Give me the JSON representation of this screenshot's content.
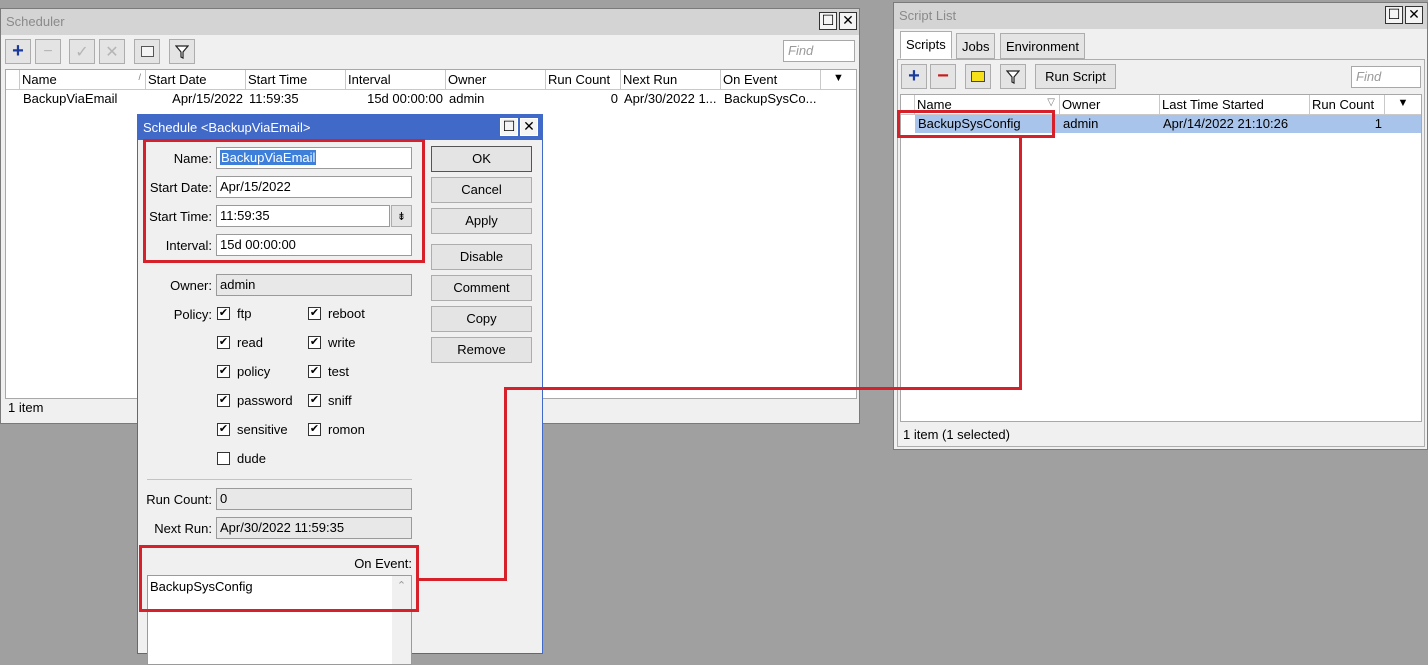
{
  "scheduler": {
    "title": "Scheduler",
    "find_placeholder": "Find",
    "columns": [
      "Name",
      "Start Date",
      "Start Time",
      "Interval",
      "Owner",
      "Run Count",
      "Next Run",
      "On Event"
    ],
    "rows": [
      {
        "name": "BackupViaEmail",
        "start_date": "Apr/15/2022",
        "start_time": "11:59:35",
        "interval": "15d 00:00:00",
        "owner": "admin",
        "run_count": "0",
        "next_run": "Apr/30/2022 1...",
        "on_event": "BackupSysCo..."
      }
    ],
    "status": "1 item"
  },
  "dialog": {
    "title": "Schedule <BackupViaEmail>",
    "name_label": "Name:",
    "name_value": "BackupViaEmail",
    "start_date_label": "Start Date:",
    "start_date_value": "Apr/15/2022",
    "start_time_label": "Start Time:",
    "start_time_value": "11:59:35",
    "interval_label": "Interval:",
    "interval_value": "15d 00:00:00",
    "owner_label": "Owner:",
    "owner_value": "admin",
    "policy_label": "Policy:",
    "policies": [
      {
        "label": "ftp",
        "checked": true
      },
      {
        "label": "reboot",
        "checked": true
      },
      {
        "label": "read",
        "checked": true
      },
      {
        "label": "write",
        "checked": true
      },
      {
        "label": "policy",
        "checked": true
      },
      {
        "label": "test",
        "checked": true
      },
      {
        "label": "password",
        "checked": true
      },
      {
        "label": "sniff",
        "checked": true
      },
      {
        "label": "sensitive",
        "checked": true
      },
      {
        "label": "romon",
        "checked": true
      },
      {
        "label": "dude",
        "checked": false
      }
    ],
    "run_count_label": "Run Count:",
    "run_count_value": "0",
    "next_run_label": "Next Run:",
    "next_run_value": "Apr/30/2022 11:59:35",
    "on_event_label": "On Event:",
    "on_event_value": "BackupSysConfig",
    "buttons": {
      "ok": "OK",
      "cancel": "Cancel",
      "apply": "Apply",
      "disable": "Disable",
      "comment": "Comment",
      "copy": "Copy",
      "remove": "Remove"
    }
  },
  "script_list": {
    "title": "Script List",
    "tabs": [
      "Scripts",
      "Jobs",
      "Environment"
    ],
    "run_script_label": "Run Script",
    "find_placeholder": "Find",
    "columns": [
      "Name",
      "Owner",
      "Last Time Started",
      "Run Count"
    ],
    "rows": [
      {
        "name": "BackupSysConfig",
        "owner": "admin",
        "last_started": "Apr/14/2022 21:10:26",
        "run_count": "1"
      }
    ],
    "status": "1 item (1 selected)"
  },
  "colors": {
    "highlight_red": "#d6202a",
    "dialog_title": "#4169c8",
    "selected_row": "#a9c4ea"
  }
}
